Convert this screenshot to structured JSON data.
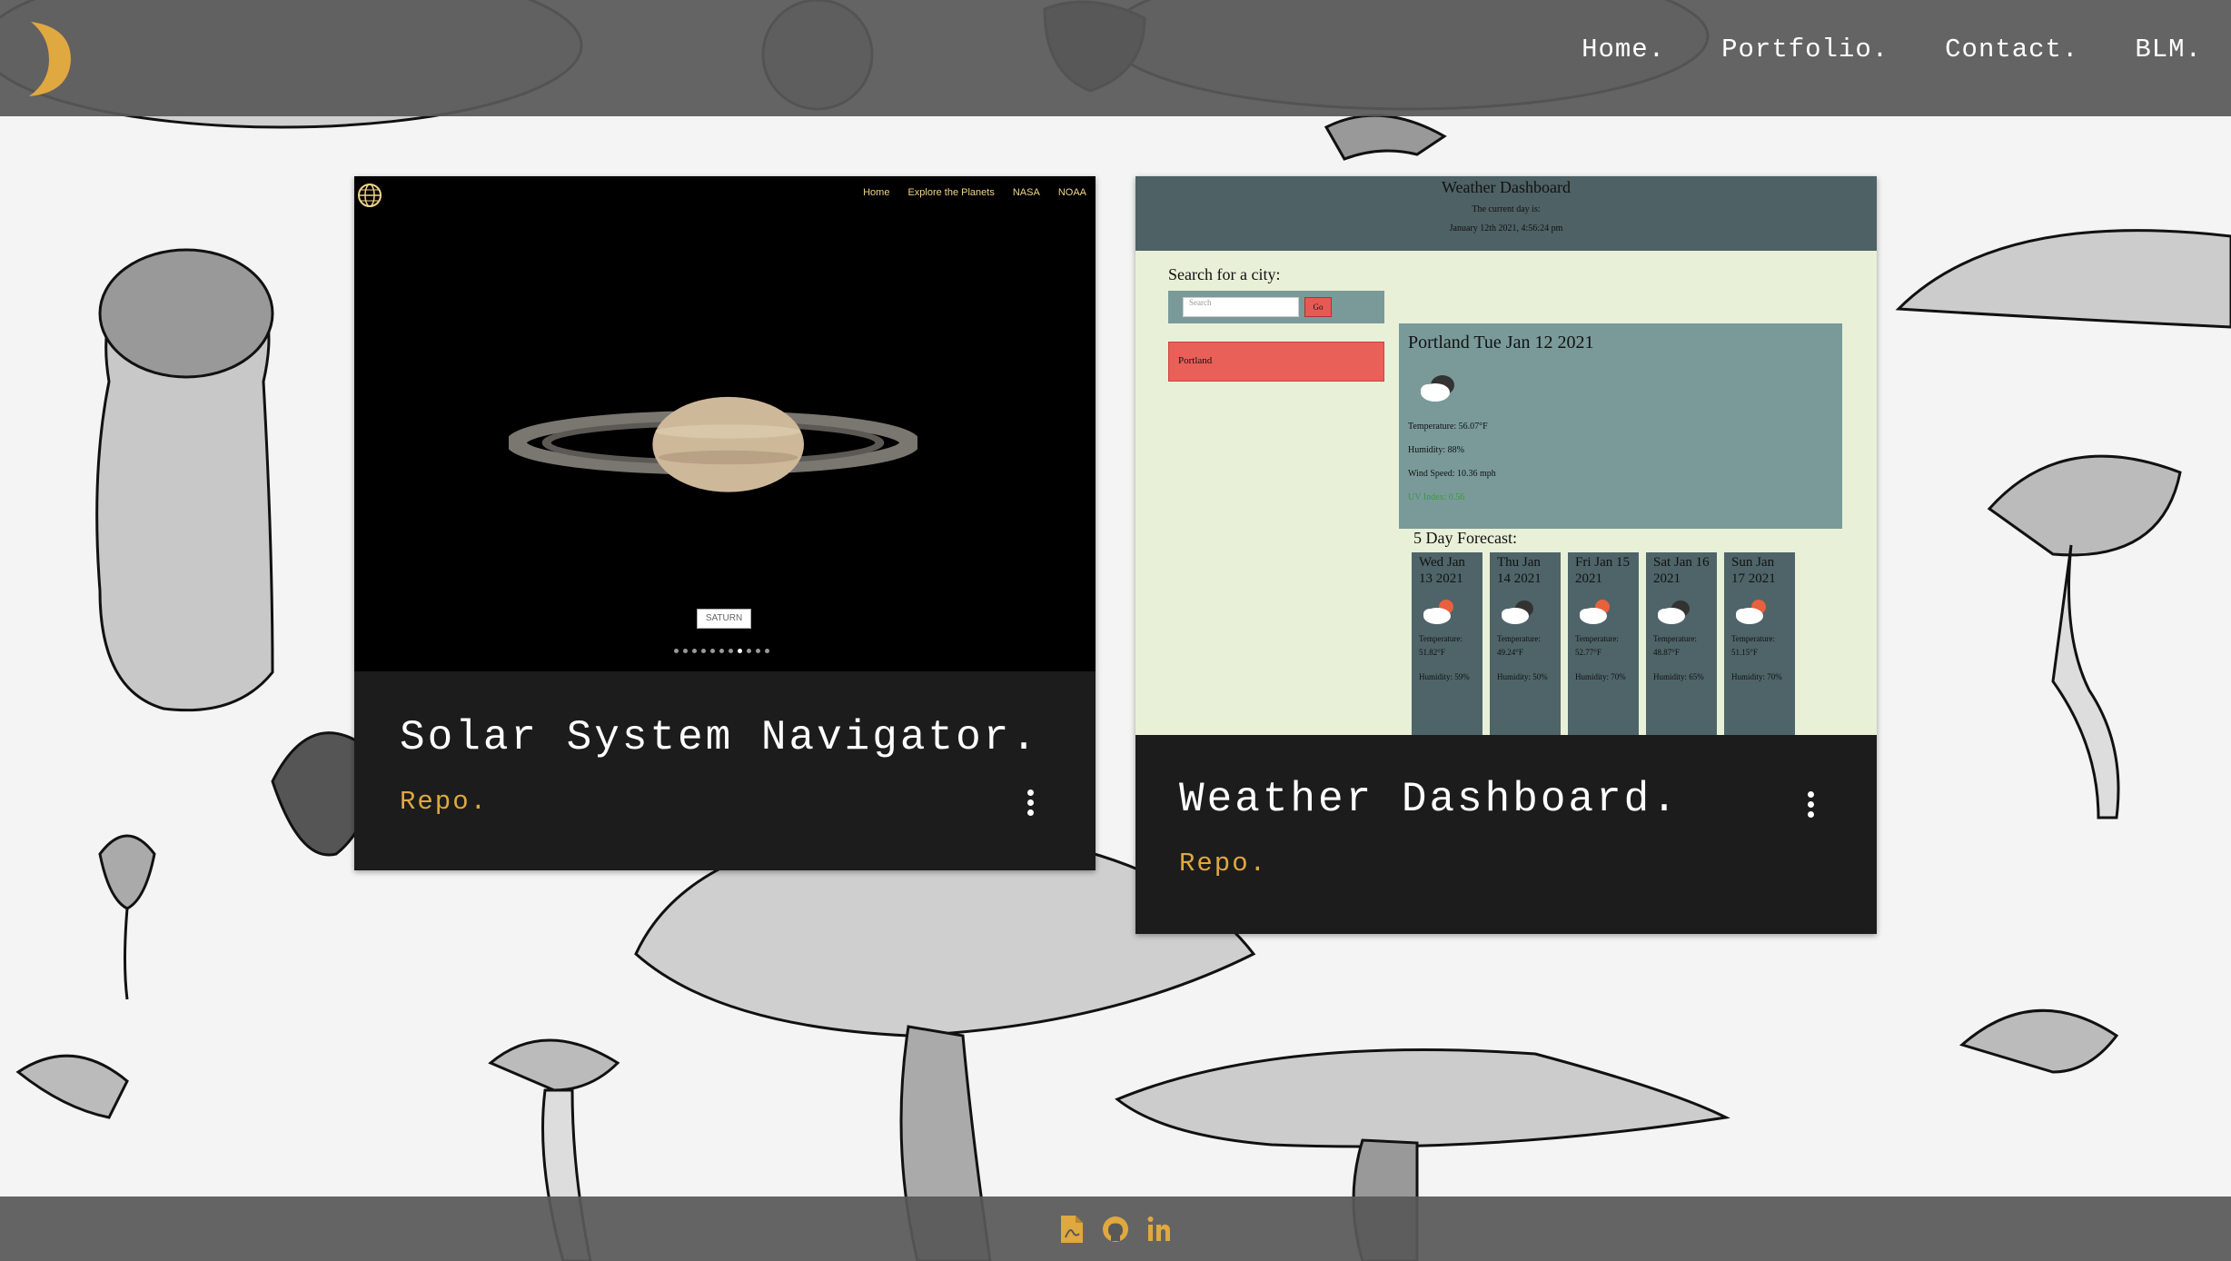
{
  "nav": {
    "home": "Home.",
    "portfolio": "Portfolio.",
    "contact": "Contact.",
    "blm": "BLM."
  },
  "projects": [
    {
      "title": "Solar System Navigator.",
      "link": "Repo.",
      "preview": {
        "nav": [
          "Home",
          "Explore the Planets",
          "NASA",
          "NOAA"
        ],
        "planet_label": "SATURN"
      }
    },
    {
      "title": "Weather Dashboard.",
      "link": "Repo.",
      "preview": {
        "title": "Weather Dashboard",
        "subtitle": "The current day is:",
        "datetime": "January 12th 2021, 4:56:24 pm",
        "search_label": "Search for a city:",
        "search_placeholder": "Search",
        "go": "Go",
        "city": "Portland",
        "current_title": "Portland Tue Jan 12 2021",
        "temperature": "Temperature: 56.07°F",
        "humidity": "Humidity: 88%",
        "wind": "Wind Speed: 10.36 mph",
        "uv": "UV Index: 0.56",
        "forecast_label": "5 Day Forecast:",
        "forecast": [
          {
            "day": "Wed Jan 13 2021",
            "temp": "Temperature: 51.82°F",
            "hum": "Humidity: 59%"
          },
          {
            "day": "Thu Jan 14 2021",
            "temp": "Temperature: 49.24°F",
            "hum": "Humidity: 50%"
          },
          {
            "day": "Fri Jan 15 2021",
            "temp": "Temperature: 52.77°F",
            "hum": "Humidity: 70%"
          },
          {
            "day": "Sat Jan 16 2021",
            "temp": "Temperature: 48.87°F",
            "hum": "Humidity: 65%"
          },
          {
            "day": "Sun Jan 17 2021",
            "temp": "Temperature: 51.15°F",
            "hum": "Humidity: 70%"
          }
        ]
      }
    }
  ],
  "footer_icons": [
    "pdf-file-icon",
    "github-icon",
    "linkedin-icon"
  ],
  "colors": {
    "accent": "#e0a840",
    "bar": "#585858",
    "card": "#1c1c1c"
  }
}
